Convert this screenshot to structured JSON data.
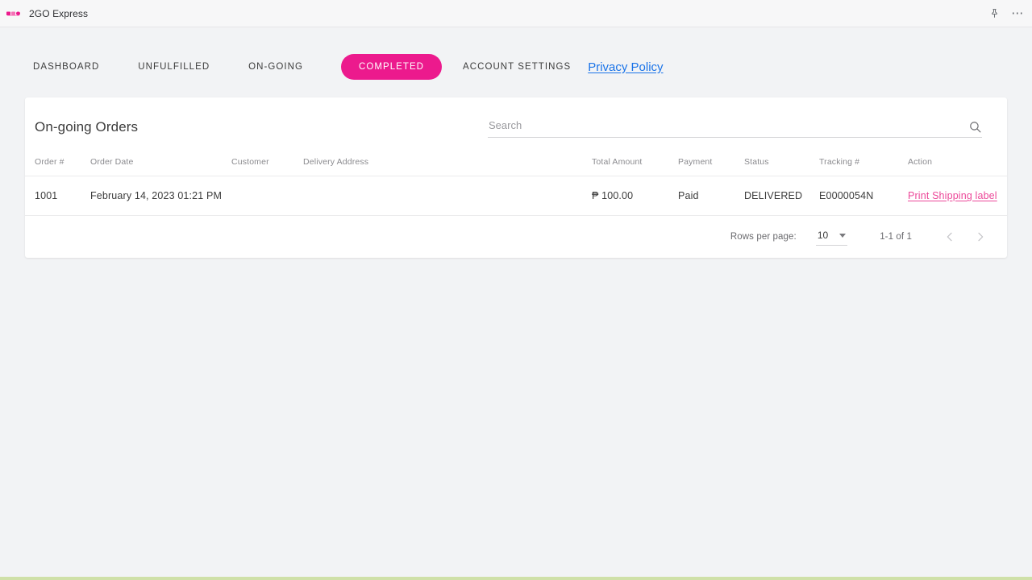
{
  "window": {
    "app_title": "2GO Express",
    "logo_icon": "2go-logo-icon",
    "pin_icon": "pin-icon",
    "more_icon": "more-options-icon",
    "accent_color": "#ec1a8d",
    "link_color": "#1a73e8",
    "bottom_strip_color": "#cfe0a8"
  },
  "nav": {
    "items": [
      {
        "label": "DASHBOARD",
        "active": false
      },
      {
        "label": "UNFULFILLED",
        "active": false
      },
      {
        "label": "ON-GOING",
        "active": false
      },
      {
        "label": "COMPLETED",
        "active": true
      },
      {
        "label": "ACCOUNT SETTINGS",
        "active": false
      }
    ],
    "privacy_policy": "Privacy Policy"
  },
  "card": {
    "title": "On-going Orders",
    "search": {
      "placeholder": "Search",
      "value": "",
      "icon": "search-icon"
    },
    "table": {
      "columns": [
        "Order #",
        "Order Date",
        "Customer",
        "Delivery Address",
        "Total Amount",
        "Payment",
        "Status",
        "Tracking #",
        "Action"
      ],
      "rows": [
        {
          "order_no": "1001",
          "order_date": "February 14, 2023 01:21 PM",
          "customer": "",
          "delivery_address": "",
          "total_amount": "₱ 100.00",
          "payment": "Paid",
          "status": "DELIVERED",
          "tracking_no": "E0000054N",
          "action": "Print Shipping label"
        }
      ]
    },
    "footer": {
      "rows_per_page_label": "Rows per page:",
      "rows_per_page_value": "10",
      "range_label": "1-1 of 1",
      "prev_icon": "chevron-left-icon",
      "next_icon": "chevron-right-icon"
    }
  }
}
